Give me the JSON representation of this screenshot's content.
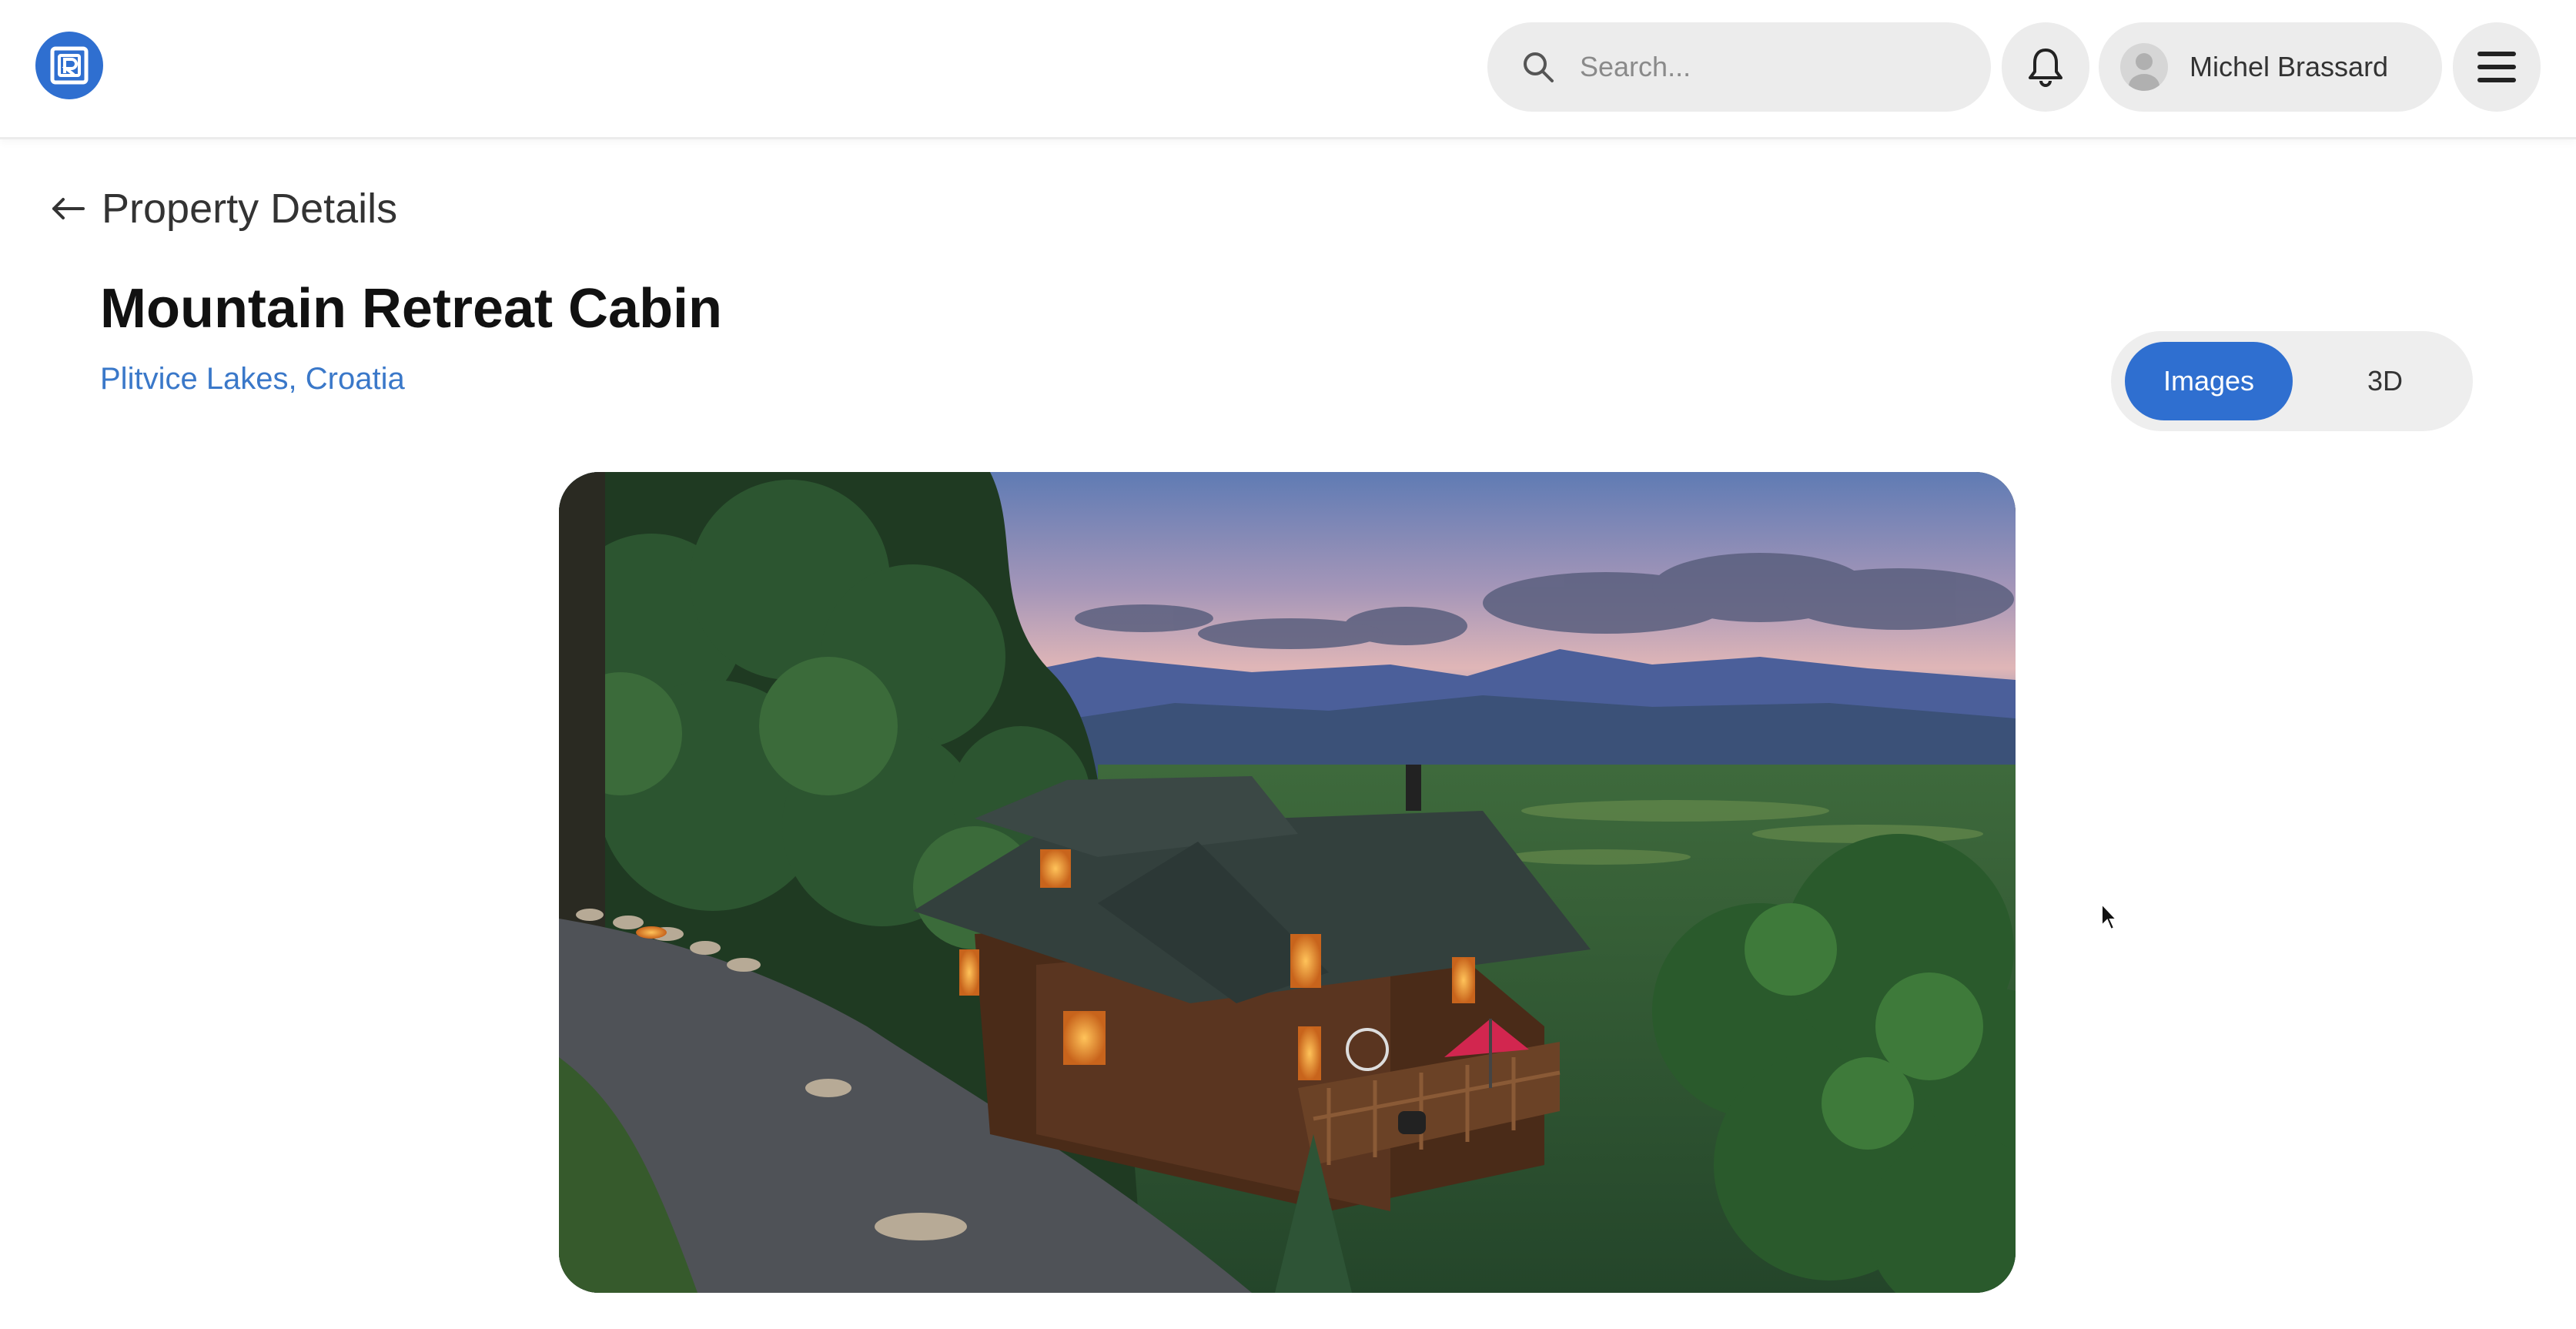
{
  "app": {
    "logo_icon": "app-logo-icon",
    "accent_color": "#2f6fd0"
  },
  "header": {
    "search": {
      "placeholder": "Search...",
      "value": "",
      "icon": "search-icon"
    },
    "notifications_icon": "bell-icon",
    "user": {
      "name": "Michel Brassard",
      "avatar_icon": "user-avatar-icon"
    },
    "menu_icon": "hamburger-menu-icon"
  },
  "page": {
    "back_label": "Property Details",
    "back_icon": "arrow-left-icon",
    "title": "Mountain Retreat Cabin",
    "location": "Plitvice Lakes, Croatia",
    "location_color": "#3a78c9"
  },
  "view_toggle": {
    "options": [
      "Images",
      "3D"
    ],
    "selected": "Images"
  },
  "hero_image": {
    "subject": "cabin-photo"
  }
}
